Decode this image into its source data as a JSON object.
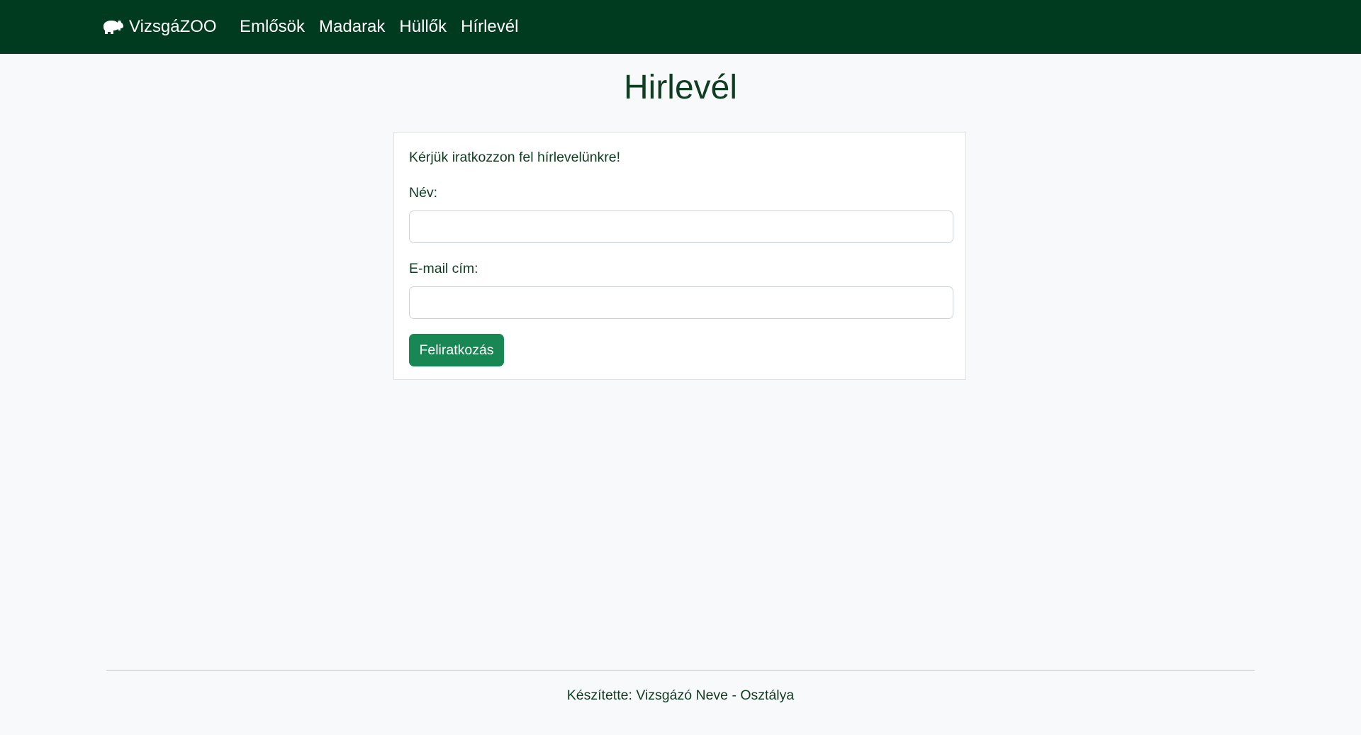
{
  "navbar": {
    "brand": "VizsgáZOO",
    "brand_icon": "hippo-icon",
    "links": [
      "Emlősök",
      "Madarak",
      "Hüllők",
      "Hírlevél"
    ]
  },
  "page": {
    "title": "Hirlevél"
  },
  "form": {
    "intro": "Kérjük iratkozzon fel hírlevelünkre!",
    "name_label": "Név:",
    "name_value": "",
    "email_label": "E-mail cím:",
    "email_value": "",
    "submit": "Feliratkozás"
  },
  "footer": {
    "text": "Készítette: Vizsgázó Neve - Osztálya"
  },
  "colors": {
    "navbar": "#003b1f",
    "button": "#198754",
    "background": "#f8f9fa"
  }
}
